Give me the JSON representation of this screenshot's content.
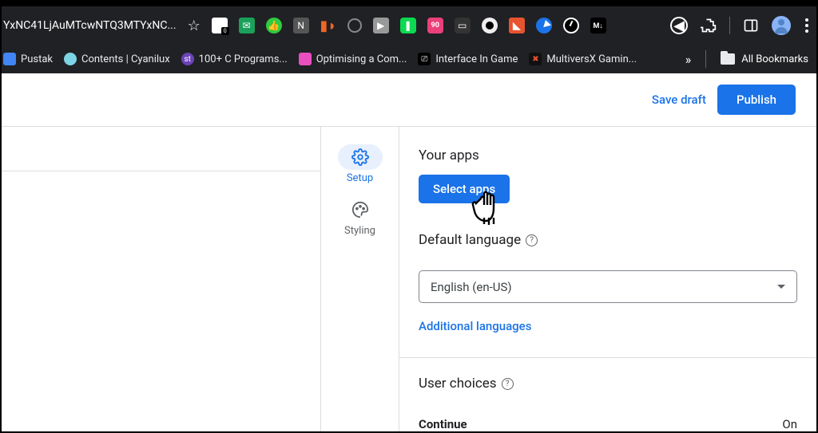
{
  "browser": {
    "url_fragment": "YxNC41LjAuMTcwNTQ3MTYxNC...",
    "extension_badge": "90",
    "bookmarks": [
      {
        "label": "Pustak",
        "color": "#4285f4"
      },
      {
        "label": "Contents | Cyanilux",
        "color": "#7cd4e4"
      },
      {
        "label": "100+ C Programs...",
        "color": "#6a43b8"
      },
      {
        "label": "Optimising a Com...",
        "color": "#e84fbf"
      },
      {
        "label": "Interface In Game",
        "color": "#000"
      },
      {
        "label": "MultiversX Gamin...",
        "color": "#111"
      }
    ],
    "all_bookmarks": "All Bookmarks"
  },
  "appbar": {
    "save_draft": "Save draft",
    "publish": "Publish"
  },
  "sidebar": {
    "setup": "Setup",
    "styling": "Styling"
  },
  "main": {
    "your_apps": "Your apps",
    "select_apps": "Select apps",
    "default_language": "Default language",
    "lang_value": "English (en-US)",
    "additional": "Additional languages",
    "user_choices": "User choices",
    "continue": "Continue",
    "continue_state": "On"
  }
}
